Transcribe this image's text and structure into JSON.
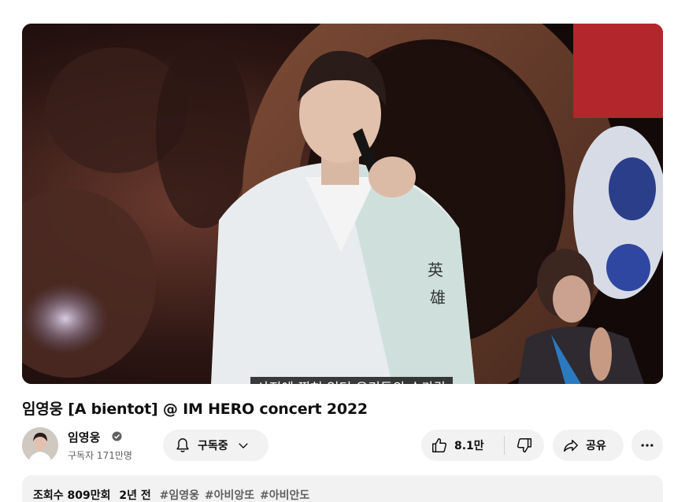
{
  "video": {
    "subtitle": "사진에 찍혀 있던 우리들의 손가락",
    "title": "임영웅 [A bientot] @ IM HERO concert 2022"
  },
  "channel": {
    "name": "임영웅",
    "subscribers": "구독자 171만명"
  },
  "actions": {
    "subscribe_label": "구독중",
    "like_count": "8.1만",
    "share_label": "공유"
  },
  "description": {
    "views": "조회수 809만회",
    "age": "2년 전",
    "hashtags": [
      "#임영웅",
      "#아비앙또",
      "#아비안도"
    ]
  },
  "icons": {
    "verified": "verified-check-icon",
    "bell": "bell-icon",
    "chevron": "chevron-down-icon",
    "like": "thumbs-up-icon",
    "dislike": "thumbs-down-icon",
    "share": "share-arrow-icon",
    "more": "more-horizontal-icon"
  },
  "colors": {
    "pill_background": "#f2f2f2",
    "secondary_text": "#606060"
  }
}
